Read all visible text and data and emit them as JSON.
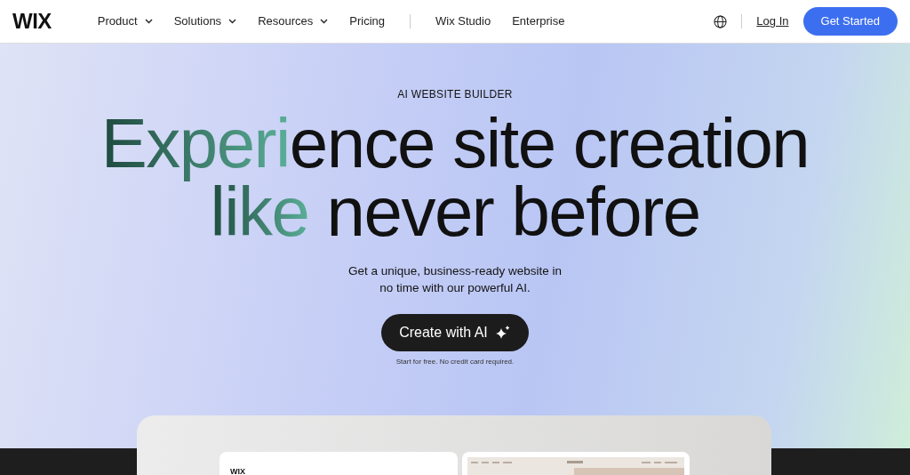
{
  "navbar": {
    "logo": "WIX",
    "links": [
      {
        "label": "Product",
        "dropdown": true
      },
      {
        "label": "Solutions",
        "dropdown": true
      },
      {
        "label": "Resources",
        "dropdown": true
      },
      {
        "label": "Pricing",
        "dropdown": false
      },
      {
        "label": "Wix Studio",
        "dropdown": false
      },
      {
        "label": "Enterprise",
        "dropdown": false
      }
    ],
    "login": "Log In",
    "cta": "Get Started"
  },
  "hero": {
    "eyebrow": "AI WEBSITE BUILDER",
    "headline": [
      {
        "accent": "Experi",
        "rest": "ence site creation"
      },
      {
        "accent": "like",
        "rest": " never before"
      }
    ],
    "subtitle": "Get a unique, business-ready website in no time with our powerful AI.",
    "button": "Create with AI",
    "note": "Start for free. No credit card required."
  },
  "preview": {
    "left_logo": "WIX"
  }
}
